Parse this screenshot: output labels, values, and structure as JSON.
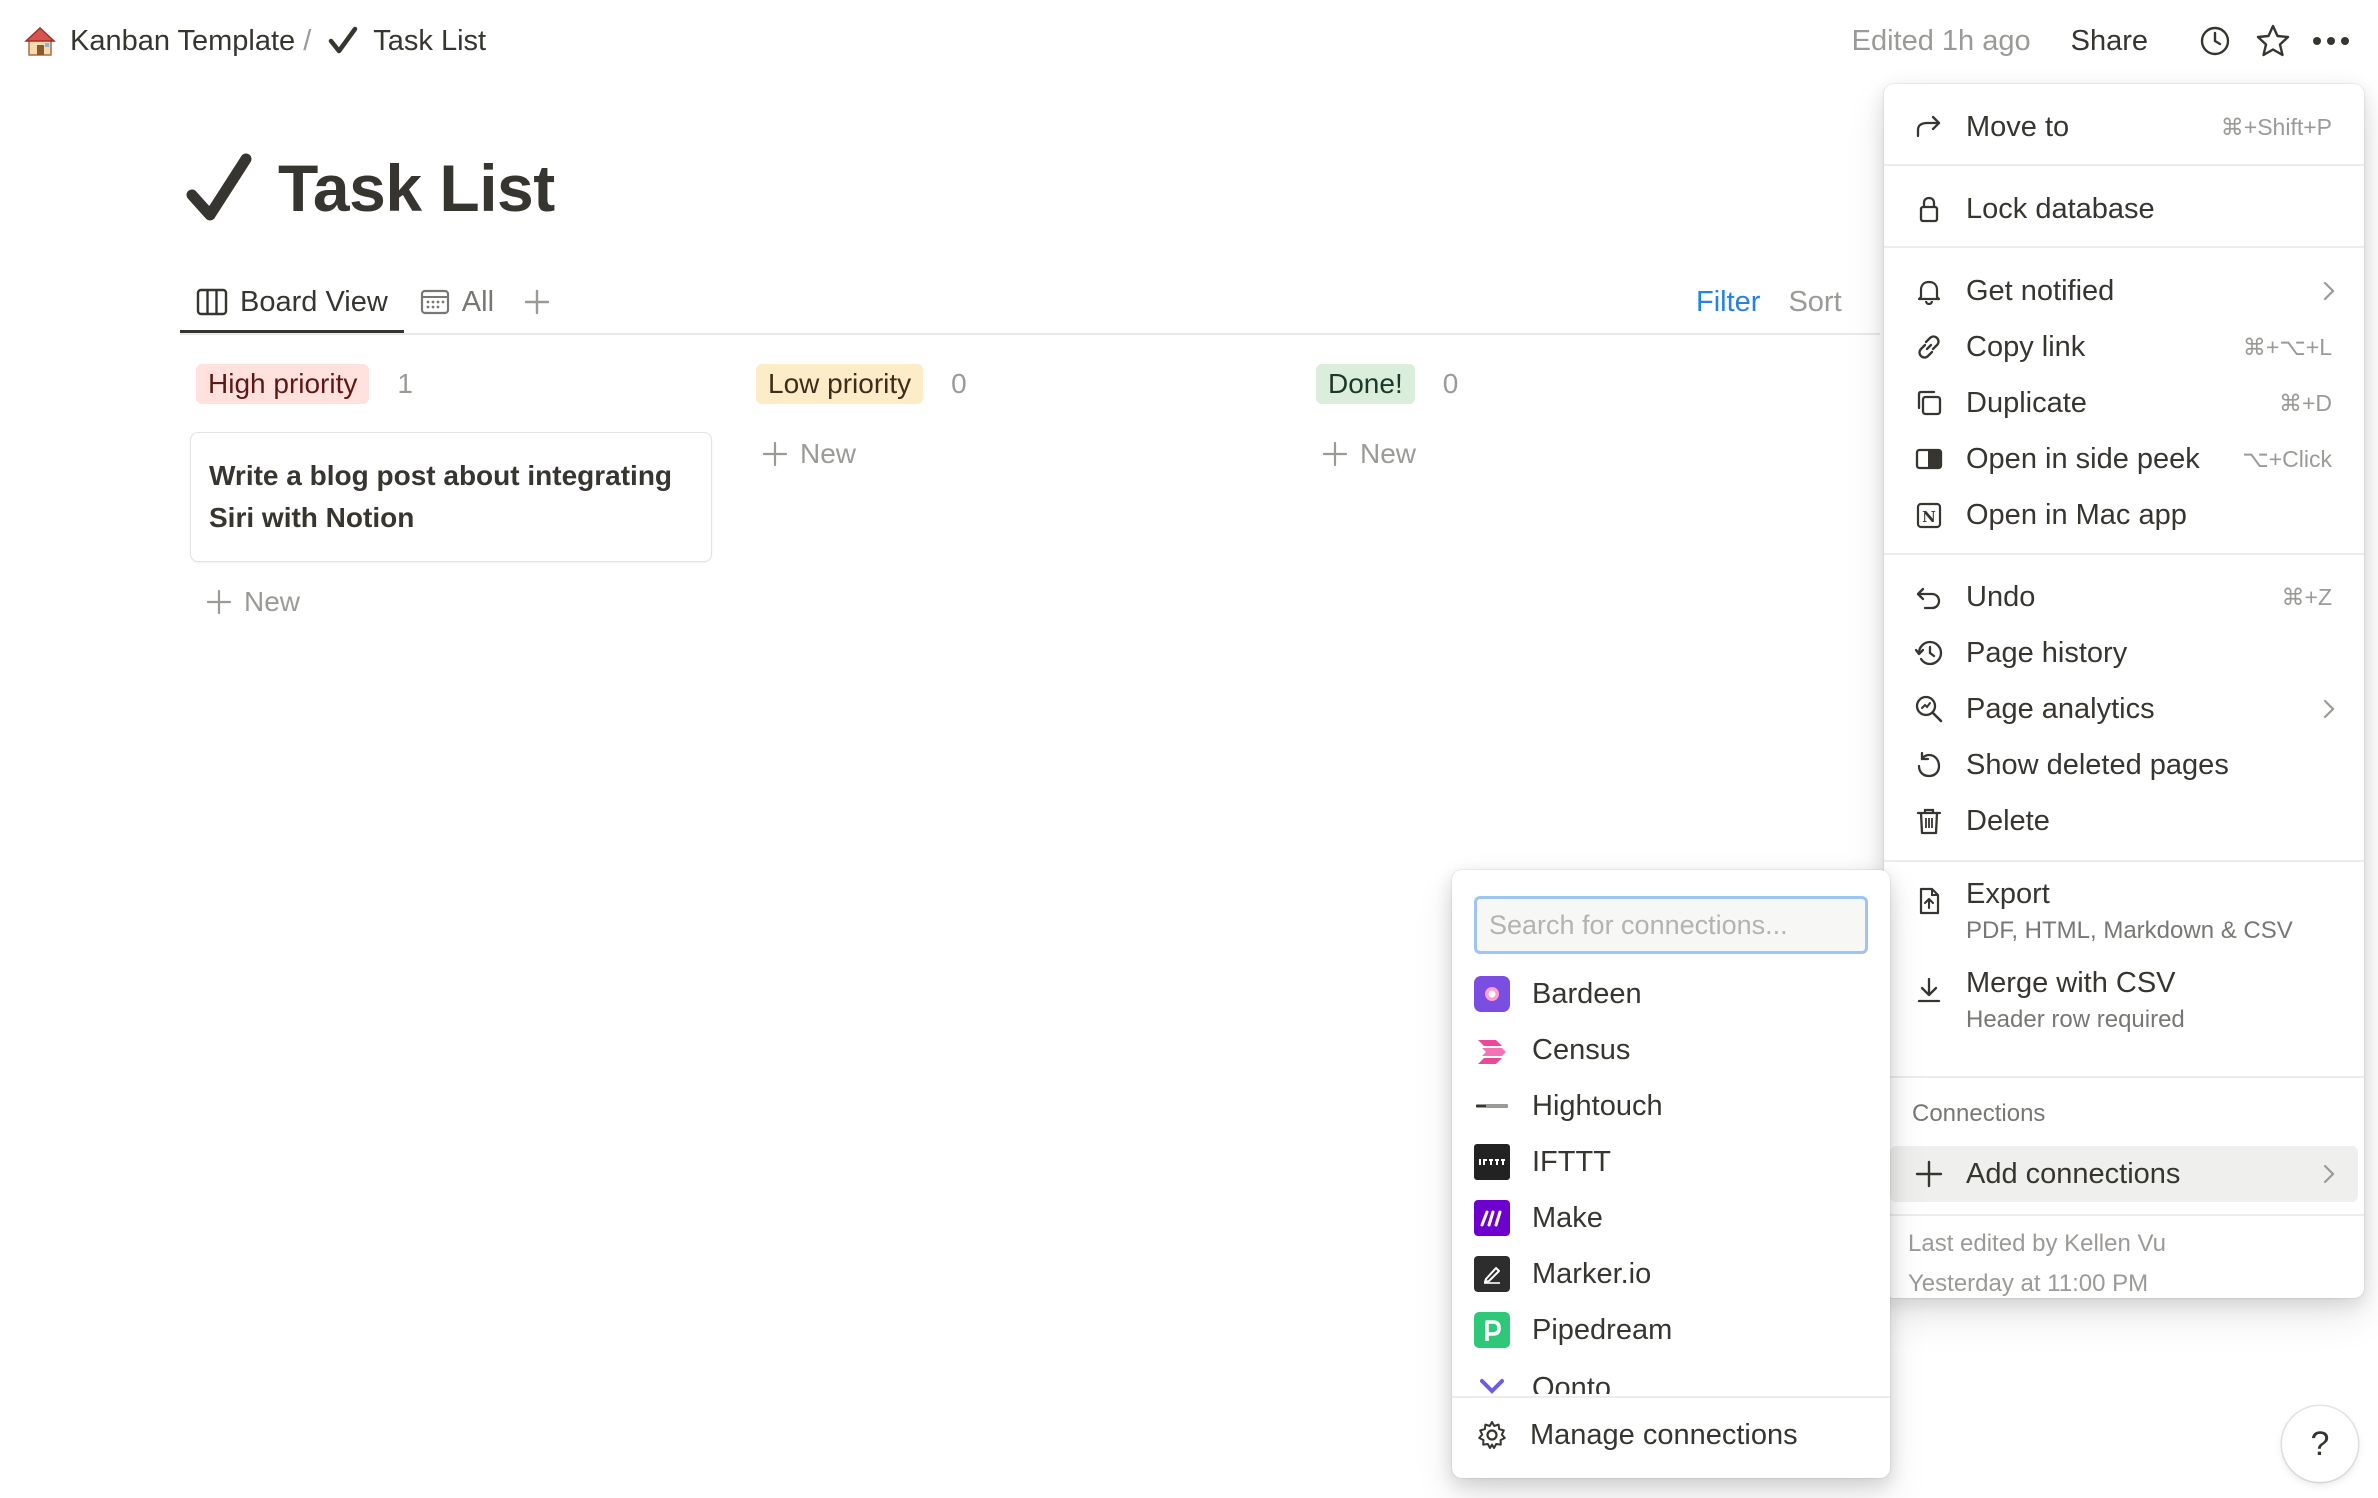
{
  "topbar": {
    "breadcrumb": [
      {
        "label": "Kanban Template",
        "icon": "house-emoji-icon"
      },
      {
        "label": "Task List",
        "icon": "checkmark-icon"
      }
    ],
    "separator": "/",
    "edited": "Edited 1h ago",
    "share": "Share"
  },
  "page": {
    "title": "Task List",
    "tabs": [
      {
        "label": "Board View",
        "icon": "board-icon",
        "active": true
      },
      {
        "label": "All",
        "icon": "calendar-icon",
        "active": false
      }
    ],
    "filter": "Filter",
    "sort": "Sort"
  },
  "board": {
    "columns": [
      {
        "label": "High priority",
        "count": "1",
        "color": "#ffe2dd",
        "text_color": "#5d1715",
        "cards": [
          "Write a blog post about integrating Siri with Notion"
        ],
        "new": "New"
      },
      {
        "label": "Low priority",
        "count": "0",
        "color": "#fdecc8",
        "text_color": "#402c1b",
        "cards": [],
        "new": "New"
      },
      {
        "label": "Done!",
        "count": "0",
        "color": "#dbeddb",
        "text_color": "#1c3829",
        "cards": [],
        "new": "New"
      }
    ]
  },
  "menu": {
    "move_to": {
      "label": "Move to",
      "shortcut": "⌘+Shift+P"
    },
    "lock": {
      "label": "Lock database"
    },
    "get_notified": {
      "label": "Get notified"
    },
    "copy_link": {
      "label": "Copy link",
      "shortcut": "⌘+⌥+L"
    },
    "duplicate": {
      "label": "Duplicate",
      "shortcut": "⌘+D"
    },
    "side_peek": {
      "label": "Open in side peek",
      "shortcut": "⌥+Click"
    },
    "mac_app": {
      "label": "Open in Mac app"
    },
    "undo": {
      "label": "Undo",
      "shortcut": "⌘+Z"
    },
    "page_history": {
      "label": "Page history"
    },
    "page_analytics": {
      "label": "Page analytics"
    },
    "show_deleted": {
      "label": "Show deleted pages"
    },
    "delete": {
      "label": "Delete"
    },
    "export": {
      "label": "Export",
      "sub": "PDF, HTML, Markdown & CSV"
    },
    "merge_csv": {
      "label": "Merge with CSV",
      "sub": "Header row required"
    },
    "connections_heading": "Connections",
    "add_connections": {
      "label": "Add connections"
    },
    "footer_line1": "Last edited by Kellen Vu",
    "footer_line2": "Yesterday at 11:00 PM"
  },
  "connections": {
    "search_placeholder": "Search for connections...",
    "items": [
      {
        "label": "Bardeen",
        "color": "#7a4ee0"
      },
      {
        "label": "Census",
        "color": "#ec4899"
      },
      {
        "label": "Hightouch",
        "color": "#ffffff"
      },
      {
        "label": "IFTTT",
        "color": "#222222"
      },
      {
        "label": "Make",
        "color": "#6d00cc"
      },
      {
        "label": "Marker.io",
        "color": "#2d2d2d"
      },
      {
        "label": "Pipedream",
        "color": "#2fc77a"
      },
      {
        "label": "Qonto",
        "color": "#6b5be6"
      }
    ],
    "manage": "Manage connections"
  },
  "help": "?"
}
